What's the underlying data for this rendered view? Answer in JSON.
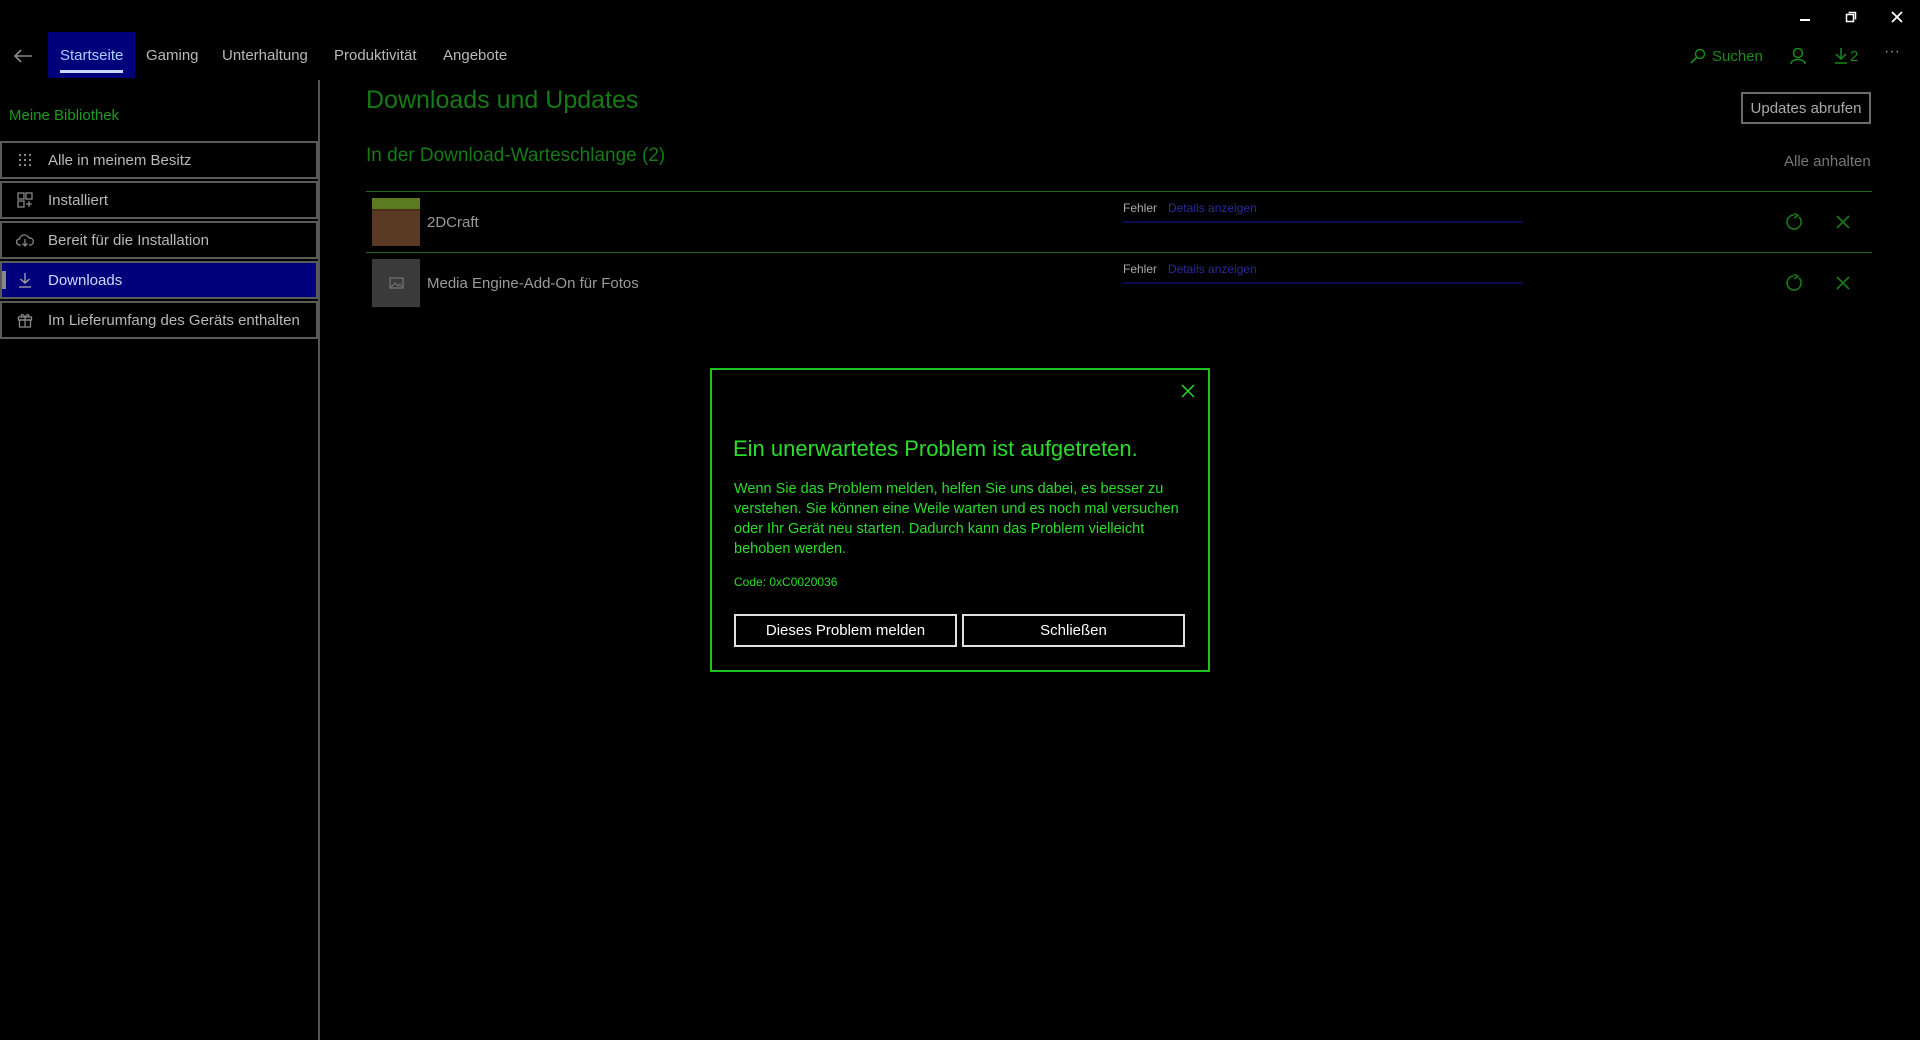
{
  "nav": {
    "tabs": [
      "Startseite",
      "Gaming",
      "Unterhaltung",
      "Produktivität",
      "Angebote"
    ],
    "search_label": "Suchen",
    "downloads_count": "2",
    "more": "···"
  },
  "sidebar": {
    "heading": "Meine Bibliothek",
    "items": [
      {
        "label": "Alle in meinem Besitz",
        "icon": "grid-dots-icon"
      },
      {
        "label": "Installiert",
        "icon": "installed-grid-icon"
      },
      {
        "label": "Bereit für die Installation",
        "icon": "cloud-download-icon"
      },
      {
        "label": "Downloads",
        "icon": "download-icon"
      },
      {
        "label": "Im Lieferumfang des Geräts enthalten",
        "icon": "gift-icon"
      }
    ]
  },
  "main": {
    "title": "Downloads und Updates",
    "updates_button": "Updates abrufen",
    "queue_title": "In der Download-Warteschlange (2)",
    "pause_all": "Alle anhalten",
    "items": [
      {
        "name": "2DCraft",
        "status": "Fehler",
        "details": "Details anzeigen"
      },
      {
        "name": "Media Engine-Add-On für Fotos",
        "status": "Fehler",
        "details": "Details anzeigen"
      }
    ]
  },
  "dialog": {
    "title": "Ein unerwartetes Problem ist aufgetreten.",
    "body": "Wenn Sie das Problem melden, helfen Sie uns dabei, es besser zu verstehen. Sie können eine Weile warten und es noch mal versuchen oder Ihr Gerät neu starten. Dadurch kann das Problem vielleicht behoben werden.",
    "code": "Code: 0xC0020036",
    "report_button": "Dieses Problem melden",
    "close_button": "Schließen"
  },
  "colors": {
    "accent_green": "#2bdc2b",
    "dark_green": "#167a16",
    "selection_blue": "#00007a"
  }
}
